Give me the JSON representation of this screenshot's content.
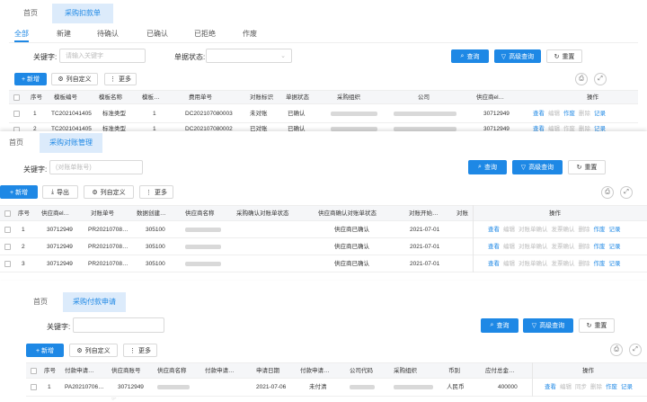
{
  "panel1": {
    "tabs": [
      "首页",
      "采购扣款单"
    ],
    "status_tabs": [
      "全部",
      "新建",
      "待确认",
      "已确认",
      "已拒绝",
      "作废"
    ],
    "keyword_label": "关键字:",
    "keyword_placeholder": "请输入关键字",
    "status_label": "单据状态:",
    "query": "查询",
    "advanced": "高级查询",
    "reset": "重置",
    "new": "+ 新增",
    "column_def": "列自定义",
    "more": "更多",
    "headers": [
      "序号",
      "模板编号",
      "模板名称",
      "模板…",
      "费用单号",
      "对账标识",
      "单据状态",
      "采购组织",
      "公司",
      "供应商el…",
      "操作"
    ],
    "rows": [
      {
        "no": "1",
        "tpl_code": "TC2021041405",
        "tpl_name": "标准类型",
        "tpl_ver": "1",
        "fee_no": "DC202107080003",
        "recon": "未对账",
        "status": "已确认",
        "supplier": "30712949"
      },
      {
        "no": "2",
        "tpl_code": "TC2021041405",
        "tpl_name": "标准类型",
        "tpl_ver": "1",
        "fee_no": "DC202107080002",
        "recon": "已对账",
        "status": "已确认",
        "supplier": "30712949"
      }
    ],
    "ops": [
      "查看",
      "编辑",
      "作废",
      "删除",
      "记录"
    ]
  },
  "panel2": {
    "tabs": [
      "首页",
      "采购对账管理"
    ],
    "keyword_label": "关键字:",
    "keyword_placeholder": "(对账单账号)",
    "query": "查询",
    "advanced": "高级查询",
    "reset": "重置",
    "new": "+ 新增",
    "export": "导出",
    "column_def": "列自定义",
    "more": "更多",
    "headers": [
      "序号",
      "供应商el…",
      "对账单号",
      "数据创建…",
      "供应商名称",
      "采购确认对账单状态",
      "供应商确认对账单状态",
      "对账开始…",
      "对账",
      "操作"
    ],
    "rows": [
      {
        "no": "1",
        "supplier": "30712949",
        "recon_no": "PR20210708…",
        "creator": "305100",
        "supplier_status": "供应商已确认",
        "start": "2021-07-01"
      },
      {
        "no": "2",
        "supplier": "30712949",
        "recon_no": "PR20210708…",
        "creator": "305100",
        "supplier_status": "供应商已确认",
        "start": "2021-07-01"
      },
      {
        "no": "3",
        "supplier": "30712949",
        "recon_no": "PR20210708…",
        "creator": "305100",
        "supplier_status": "供应商已确认",
        "start": "2021-07-01"
      }
    ],
    "ops": [
      "查看",
      "编辑",
      "对账单确认",
      "发票确认",
      "删除",
      "作废",
      "记录"
    ]
  },
  "panel3": {
    "tabs": [
      "首页",
      "采购付款申请"
    ],
    "keyword_label": "关键字:",
    "query": "查询",
    "advanced": "高级查询",
    "reset": "重置",
    "new": "+ 新增",
    "column_def": "列自定义",
    "more": "更多",
    "headers": [
      "序号",
      "付款申请…",
      "供应商账号",
      "供应商名称",
      "付款申请…",
      "申请日期",
      "付款申请…",
      "公司代码",
      "采购组织",
      "币别",
      "应付总金…",
      "操作"
    ],
    "rows": [
      {
        "no": "1",
        "apply_no": "PA20210706…",
        "account": "30712949",
        "date": "2021-07-06",
        "status": "未付清",
        "currency": "人民币",
        "amount": "400000"
      }
    ],
    "ops": [
      "查看",
      "编辑",
      "同步",
      "删除",
      "作废",
      "记录"
    ]
  }
}
